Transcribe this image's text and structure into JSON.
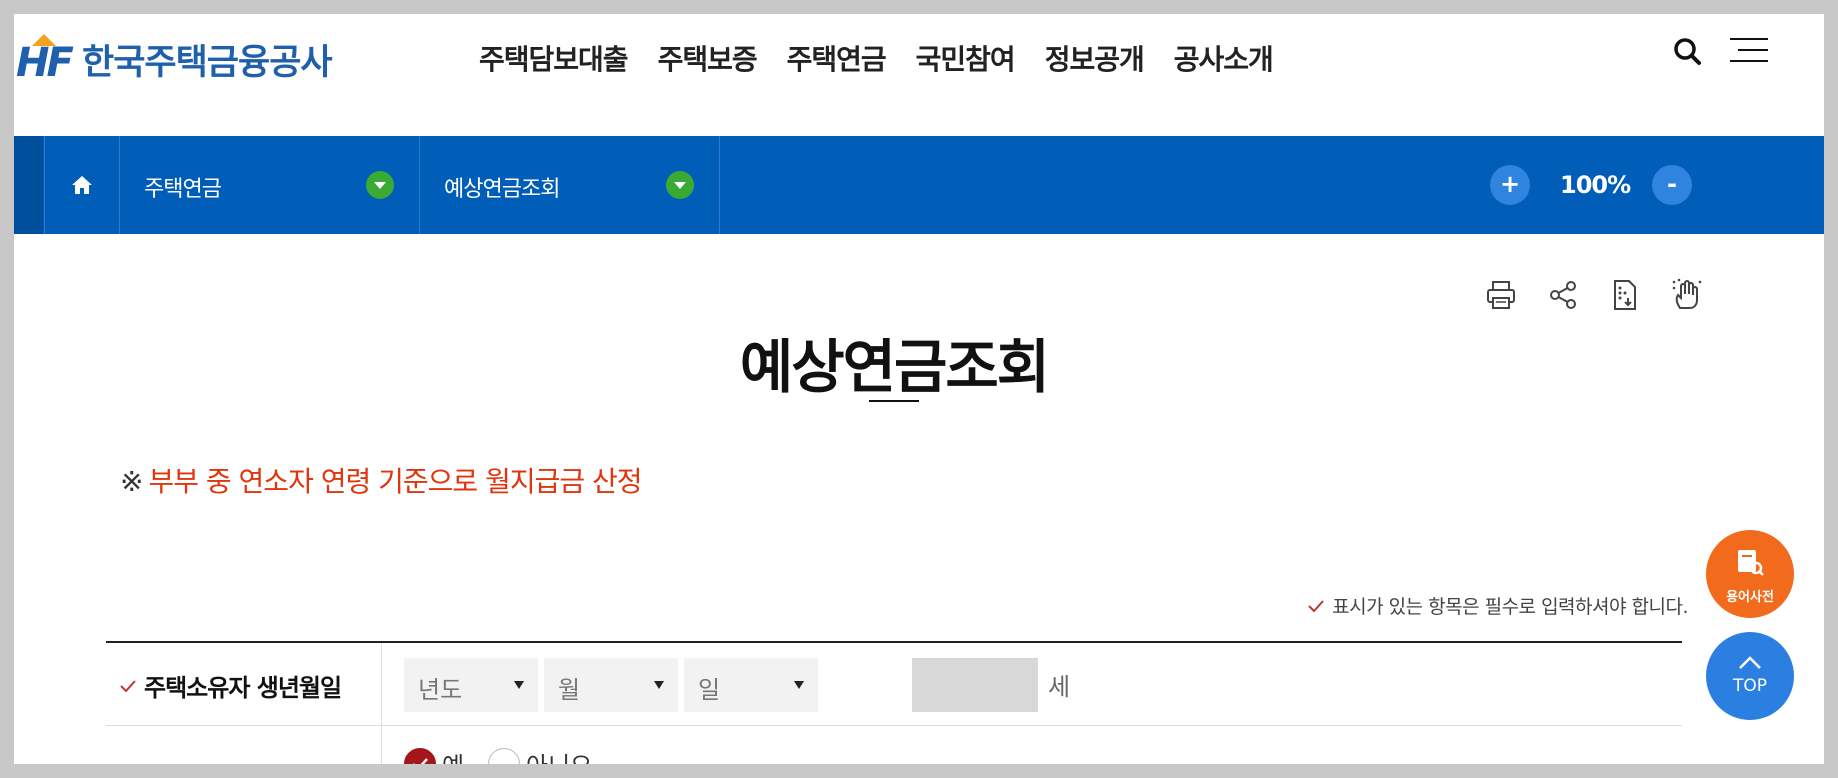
{
  "header": {
    "logo_mark": "HF",
    "logo_text": "한국주택금융공사",
    "nav": [
      "주택담보대출",
      "주택보증",
      "주택연금",
      "국민참여",
      "정보공개",
      "공사소개"
    ]
  },
  "location": {
    "depth1": "주택연금",
    "depth2": "예상연금조회",
    "zoom_plus": "+",
    "zoom_value": "100%",
    "zoom_minus": "-"
  },
  "page": {
    "title": "예상연금조회",
    "notice_mark": "※",
    "notice_text": "부부 중 연소자 연령 기준으로 월지급금 산정",
    "required_note": "표시가 있는 항목은 필수로 입력하셔야 합니다."
  },
  "form": {
    "birth_label": "주택소유자 생년월일",
    "year_placeholder": "년도",
    "month_placeholder": "월",
    "day_placeholder": "일",
    "age_unit": "세",
    "radio_yes": "예",
    "radio_no": "아니오"
  },
  "floating": {
    "dict_label": "용어사전",
    "top_label": "TOP"
  },
  "colors": {
    "brand_blue": "#005eb8",
    "accent_green": "#3aaa35",
    "notice_red": "#e0350d",
    "dict_orange": "#f26a1b",
    "top_blue": "#2b7fe0",
    "radio_red": "#a3161c"
  }
}
